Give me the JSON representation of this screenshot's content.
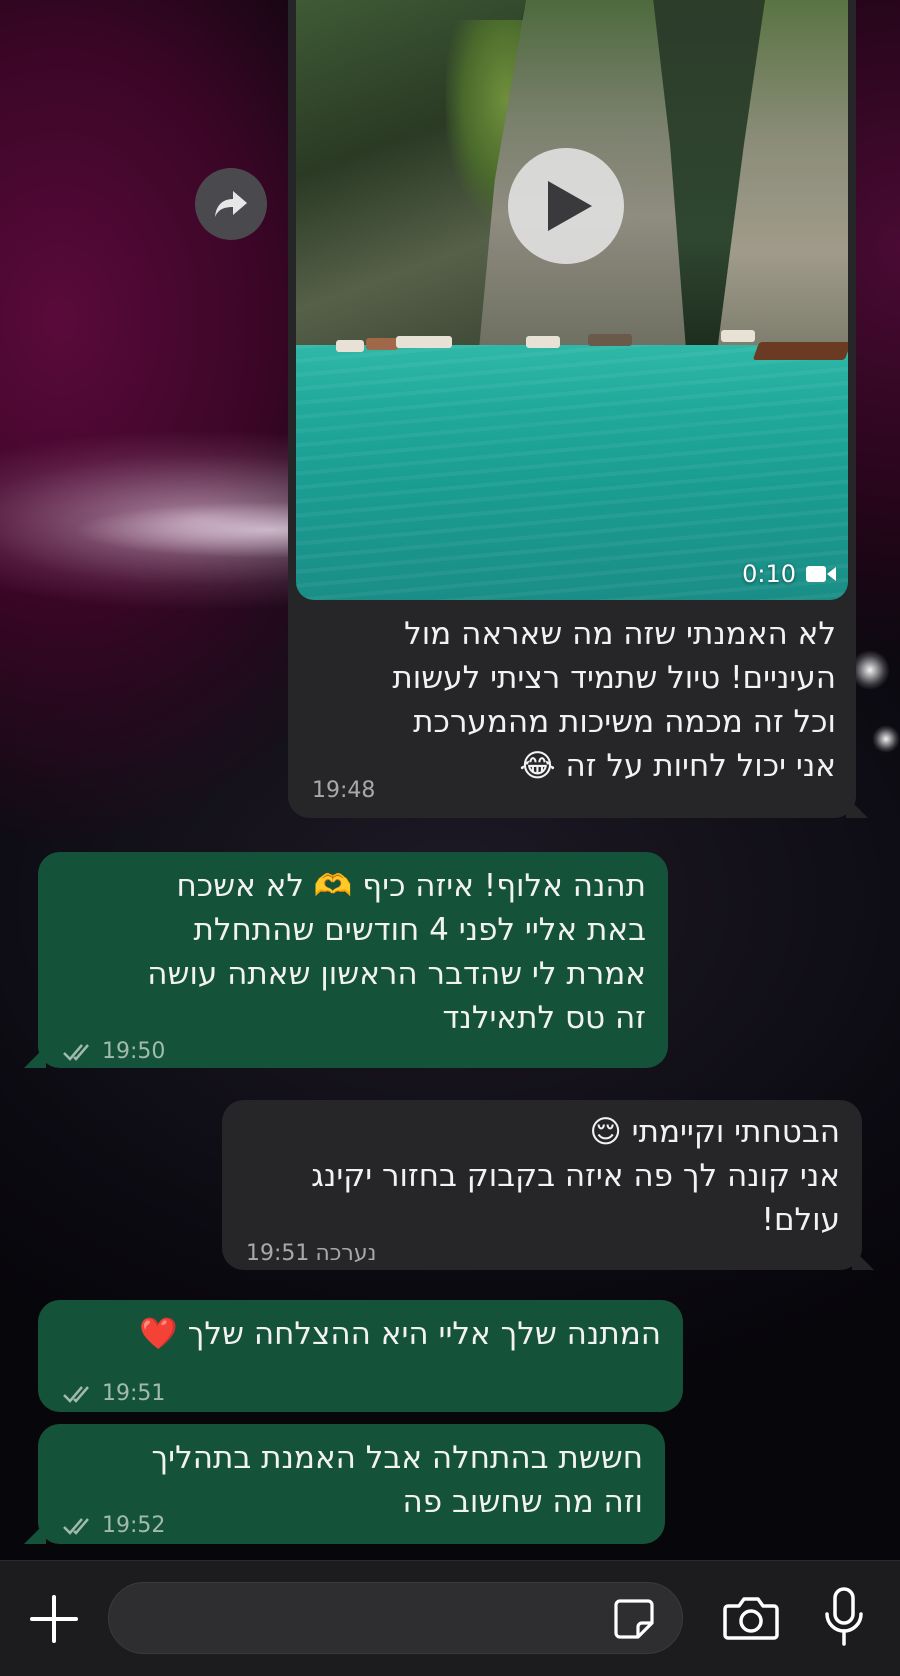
{
  "messages": [
    {
      "id": "m1",
      "direction": "incoming",
      "type": "video",
      "video_duration": "0:10",
      "lines": [
        "לא האמנתי שזה מה שאראה מול",
        "העיניים! טיול שתמיד רציתי לעשות",
        "וכל זה מכמה משיכות מהמערכת",
        "אני יכול לחיות על זה 😂"
      ],
      "time": "19:48"
    },
    {
      "id": "m2",
      "direction": "outgoing",
      "lines": [
        "תהנה אלוף! איזה כיף 🫶 לא אשכח",
        "באת אליי לפני 4 חודשים שהתחלת",
        "אמרת לי שהדבר הראשון שאתה עושה",
        "זה טס לתאילנד"
      ],
      "time": "19:50",
      "status": "read"
    },
    {
      "id": "m3",
      "direction": "incoming",
      "lines": [
        "הבטחתי וקיימתי 😌",
        "אני קונה לך פה איזה בקבוק בחזור יקינג",
        "עולם!"
      ],
      "edited_label": "נערכה",
      "time": "19:51"
    },
    {
      "id": "m4",
      "direction": "outgoing",
      "lines": [
        "המתנה שלך אליי היא ההצלחה שלך ❤️"
      ],
      "time": "19:51",
      "status": "read"
    },
    {
      "id": "m5",
      "direction": "outgoing",
      "lines": [
        "חששת בהתחלה אבל האמנת בתהליך",
        "וזה מה שחשוב פה"
      ],
      "time": "19:52",
      "status": "read"
    }
  ],
  "composer": {
    "placeholder": "",
    "icons": [
      "plus-icon",
      "sticker-icon",
      "camera-icon",
      "microphone-icon"
    ]
  },
  "colors": {
    "incoming_bubble": "#262628",
    "outgoing_bubble": "#14523a",
    "composer_bg": "#1c1c1e"
  }
}
